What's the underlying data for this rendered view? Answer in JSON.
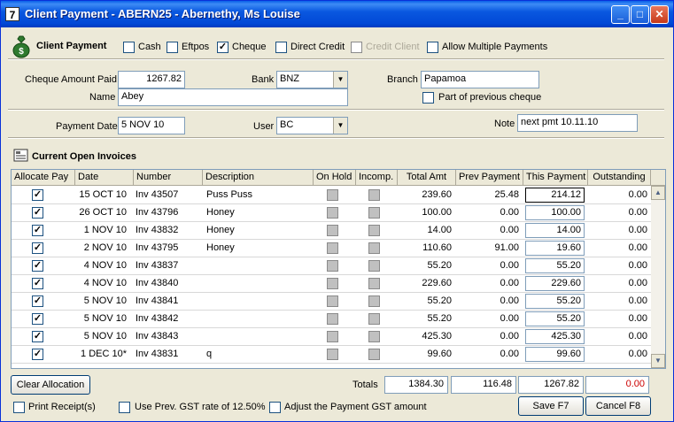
{
  "window": {
    "app_icon_text": "7",
    "title": "Client Payment - ABERN25 - Abernethy, Ms Louise",
    "min_glyph": "_",
    "max_glyph": "□",
    "close_glyph": "✕"
  },
  "header": {
    "section_title": "Client Payment",
    "options": [
      {
        "label": "Cash",
        "checked": false,
        "enabled": true
      },
      {
        "label": "Eftpos",
        "checked": false,
        "enabled": true
      },
      {
        "label": "Cheque",
        "checked": true,
        "enabled": true
      },
      {
        "label": "Direct Credit",
        "checked": false,
        "enabled": true
      },
      {
        "label": "Credit Client",
        "checked": false,
        "enabled": false
      },
      {
        "label": "Allow Multiple Payments",
        "checked": false,
        "enabled": true
      }
    ]
  },
  "cheque": {
    "amount_label": "Cheque Amount Paid",
    "amount_value": "1267.82",
    "name_label": "Name",
    "name_value": "Abey",
    "bank_label": "Bank",
    "bank_value": "BNZ",
    "branch_label": "Branch",
    "branch_value": "Papamoa",
    "part_prev_label": "Part of previous cheque",
    "part_prev_checked": false
  },
  "payment": {
    "date_label": "Payment Date",
    "date_value": "5 NOV 10",
    "user_label": "User",
    "user_value": "BC",
    "note_label": "Note",
    "note_value": "next pmt 10.11.10"
  },
  "invoices": {
    "title": "Current Open Invoices",
    "columns": [
      "Allocate Pay",
      "Date",
      "Number",
      "Description",
      "On Hold",
      "Incomp.",
      "Total Amt",
      "Prev Payment",
      "This Payment",
      "Outstanding"
    ],
    "rows": [
      {
        "allocate": true,
        "date": "15 OCT 10",
        "number": "Inv 43507",
        "description": "Puss Puss",
        "on_hold": false,
        "total": "239.60",
        "prev": "25.48",
        "this": "214.12",
        "outstanding": "0.00"
      },
      {
        "allocate": true,
        "date": "26 OCT 10",
        "number": "Inv 43796",
        "description": "Honey",
        "on_hold": false,
        "total": "100.00",
        "prev": "0.00",
        "this": "100.00",
        "outstanding": "0.00"
      },
      {
        "allocate": true,
        "date": "1 NOV 10",
        "number": "Inv 43832",
        "description": "Honey",
        "on_hold": false,
        "total": "14.00",
        "prev": "0.00",
        "this": "14.00",
        "outstanding": "0.00"
      },
      {
        "allocate": true,
        "date": "2 NOV 10",
        "number": "Inv 43795",
        "description": "Honey",
        "on_hold": false,
        "total": "110.60",
        "prev": "91.00",
        "this": "19.60",
        "outstanding": "0.00"
      },
      {
        "allocate": true,
        "date": "4 NOV 10",
        "number": "Inv 43837",
        "description": "",
        "on_hold": false,
        "total": "55.20",
        "prev": "0.00",
        "this": "55.20",
        "outstanding": "0.00"
      },
      {
        "allocate": true,
        "date": "4 NOV 10",
        "number": "Inv 43840",
        "description": "",
        "on_hold": false,
        "total": "229.60",
        "prev": "0.00",
        "this": "229.60",
        "outstanding": "0.00"
      },
      {
        "allocate": true,
        "date": "5 NOV 10",
        "number": "Inv 43841",
        "description": "",
        "on_hold": false,
        "total": "55.20",
        "prev": "0.00",
        "this": "55.20",
        "outstanding": "0.00"
      },
      {
        "allocate": true,
        "date": "5 NOV 10",
        "number": "Inv 43842",
        "description": "",
        "on_hold": false,
        "total": "55.20",
        "prev": "0.00",
        "this": "55.20",
        "outstanding": "0.00"
      },
      {
        "allocate": true,
        "date": "5 NOV 10",
        "number": "Inv 43843",
        "description": "",
        "on_hold": false,
        "total": "425.30",
        "prev": "0.00",
        "this": "425.30",
        "outstanding": "0.00"
      },
      {
        "allocate": true,
        "date": "1 DEC 10*",
        "number": "Inv 43831",
        "description": "q",
        "on_hold": false,
        "total": "99.60",
        "prev": "0.00",
        "this": "99.60",
        "outstanding": "0.00"
      }
    ]
  },
  "totals": {
    "label": "Totals",
    "total_amt": "1384.30",
    "prev_payment": "116.48",
    "this_payment": "1267.82",
    "outstanding": "0.00"
  },
  "footer": {
    "clear_allocation": "Clear Allocation",
    "print_receipts": "Print Receipt(s)",
    "use_prev_gst": "Use Prev. GST rate of 12.50%",
    "adjust_gst": "Adjust the Payment GST amount",
    "save": "Save F7",
    "cancel": "Cancel F8"
  },
  "colors": {
    "title_bar": "#0a58e0",
    "outstanding_total": "#cc0000"
  }
}
